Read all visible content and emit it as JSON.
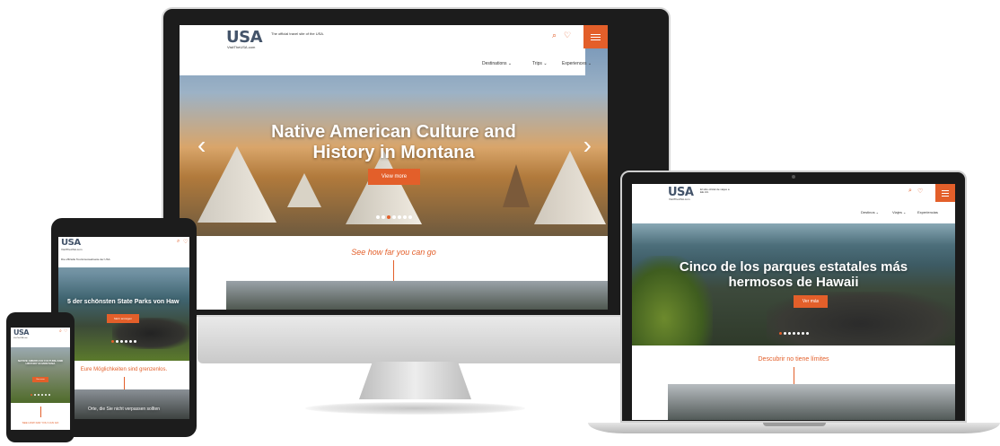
{
  "colors": {
    "accent": "#e35f2a",
    "logo": "#44546a",
    "frame": "#1a1a1a"
  },
  "site": {
    "logo": "USA",
    "logo_sub": "VisitTheUSA.com"
  },
  "desktop": {
    "tagline": "The official travel site of the USA.",
    "nav": [
      "Destinations",
      "Trips",
      "Experiences"
    ],
    "hero_title": "Native American Culture and History in Montana",
    "hero_button": "View more",
    "section_heading": "See how far you can go",
    "slides": 7,
    "active_slide": 3
  },
  "laptop": {
    "tagline": "El sitio oficial de viajes a EE.UU.",
    "nav": [
      "Destinos",
      "Viajes",
      "Experiencias"
    ],
    "hero_title": "Cinco de los parques estatales más hermosos de Hawaii",
    "hero_button": "Ver más",
    "section_heading": "Descubrir no tiene límites",
    "slides": 7,
    "active_slide": 1
  },
  "tablet": {
    "tagline": "Die offizielle Tourismuswebseite der USA",
    "hero_title": "5 der schönsten State Parks von Haw",
    "hero_button": "Mehr anzeigen",
    "section_heading": "Eure Möglichkeiten sind grenzenlos.",
    "footer_text": "Orte, die Sie nicht verpassen sollten",
    "slides": 6
  },
  "phone": {
    "hero_title": "NATIVE AMERICAN CULTURE AND HISTORY IN MONTANA",
    "hero_button": "View more",
    "footer_text": "SEE HOW FAR YOU CAN GO",
    "slides": 6
  }
}
